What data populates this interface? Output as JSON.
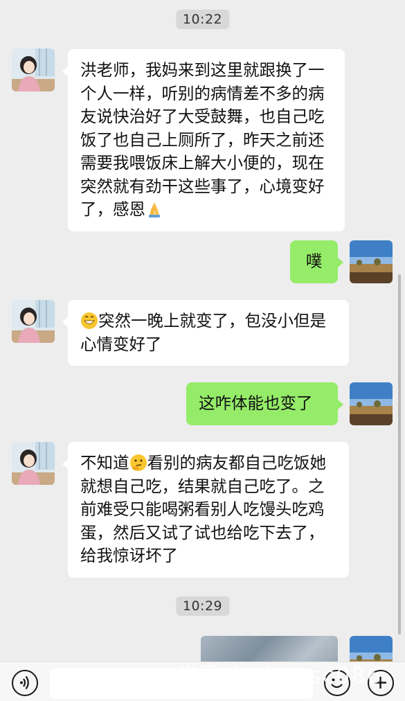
{
  "timestamps": [
    "10:22",
    "10:29"
  ],
  "messages": [
    {
      "side": "left",
      "sender": "contact",
      "text": "洪老师，我妈来到这里就跟换了一个人一样，听别的病情差不多的病友说快治好了大受鼓舞，也自己吃饭了也自己上厕所了，昨天之前还需要我喂饭床上解大小便的，现在突然就有劲干这些事了，心境变好了，感恩",
      "trailing_emoji": "folded-hands-emoji"
    },
    {
      "side": "right",
      "sender": "me",
      "text": "噗"
    },
    {
      "side": "left",
      "sender": "contact",
      "leading_emoji": "grinning-face-emoji",
      "text": "突然一晚上就变了，包没小但是心情变好了"
    },
    {
      "side": "right",
      "sender": "me",
      "text": "这咋体能也变了"
    },
    {
      "side": "left",
      "sender": "contact",
      "text_before": "不知道",
      "inline_emoji": "thinking-face-emoji",
      "text_after": "看别的病友都自己吃饭她就想自己吃，结果就自己吃了。之前难受只能喝粥看别人吃馒头吃鸡蛋，然后又试了试也给吃下去了，给我惊讶坏了"
    },
    {
      "side": "right",
      "sender": "me",
      "type": "image"
    }
  ],
  "watermark": "@洪飞 in baosc086",
  "input_bar": {
    "voice_icon": "voice-icon",
    "emoji_icon": "emoji-icon",
    "plus_icon": "plus-icon",
    "input_value": ""
  },
  "colors": {
    "background": "#ededed",
    "my_bubble": "#95ec69",
    "their_bubble": "#ffffff"
  }
}
